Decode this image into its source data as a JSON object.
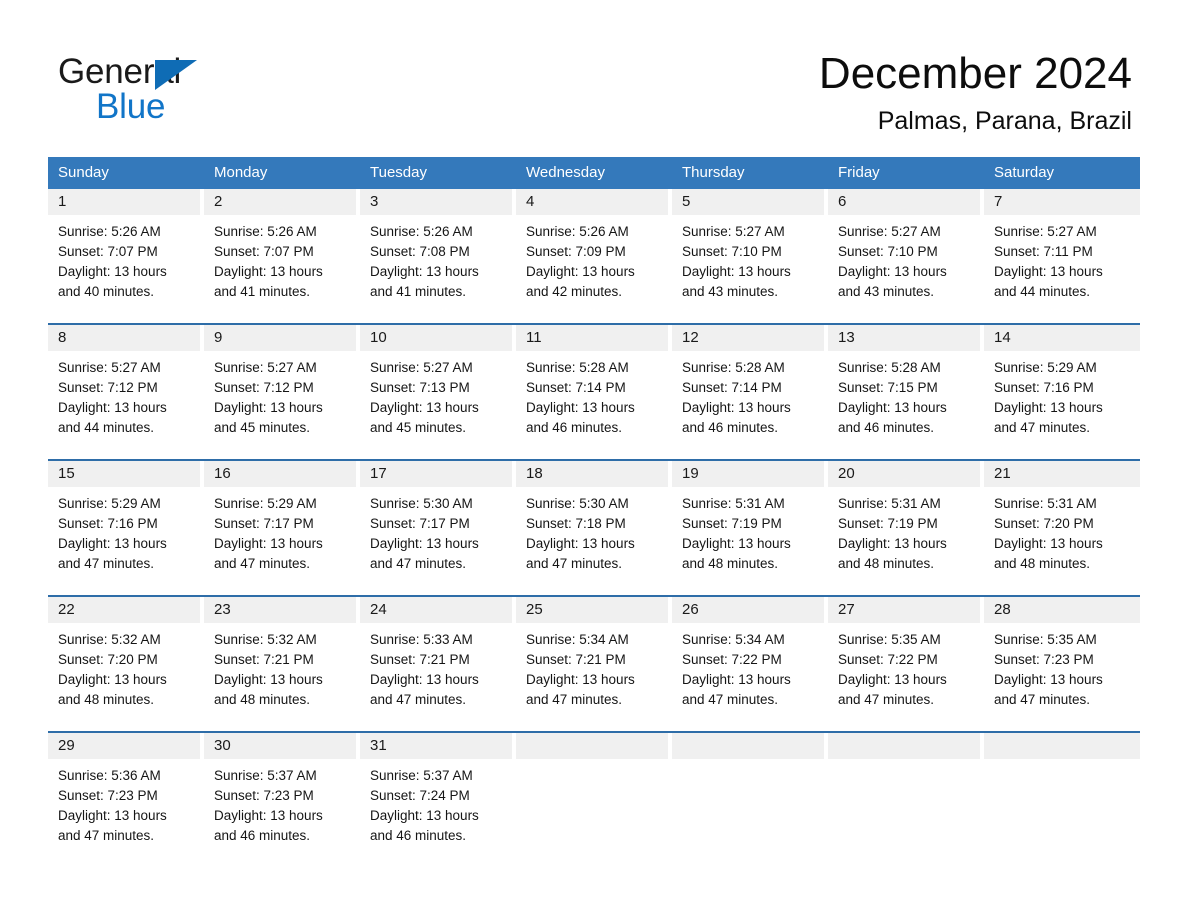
{
  "brand": {
    "name_part1": "General",
    "name_part2": "Blue",
    "accent_color": "#1175c8",
    "triangle_color": "#0f6cb5",
    "triangle_icon": "brand-triangle-icon"
  },
  "header": {
    "title": "December 2024",
    "subtitle": "Palmas, Parana, Brazil"
  },
  "calendar": {
    "header_bg": "#3479bb",
    "header_text_color": "#ffffff",
    "row_divider_color": "#2e6da8",
    "day_band_bg": "#f0f0f0",
    "weekdays": [
      "Sunday",
      "Monday",
      "Tuesday",
      "Wednesday",
      "Thursday",
      "Friday",
      "Saturday"
    ],
    "weeks": [
      [
        {
          "date": "1",
          "sunrise": "Sunrise: 5:26 AM",
          "sunset": "Sunset: 7:07 PM",
          "daylight_line1": "Daylight: 13 hours",
          "daylight_line2": "and 40 minutes."
        },
        {
          "date": "2",
          "sunrise": "Sunrise: 5:26 AM",
          "sunset": "Sunset: 7:07 PM",
          "daylight_line1": "Daylight: 13 hours",
          "daylight_line2": "and 41 minutes."
        },
        {
          "date": "3",
          "sunrise": "Sunrise: 5:26 AM",
          "sunset": "Sunset: 7:08 PM",
          "daylight_line1": "Daylight: 13 hours",
          "daylight_line2": "and 41 minutes."
        },
        {
          "date": "4",
          "sunrise": "Sunrise: 5:26 AM",
          "sunset": "Sunset: 7:09 PM",
          "daylight_line1": "Daylight: 13 hours",
          "daylight_line2": "and 42 minutes."
        },
        {
          "date": "5",
          "sunrise": "Sunrise: 5:27 AM",
          "sunset": "Sunset: 7:10 PM",
          "daylight_line1": "Daylight: 13 hours",
          "daylight_line2": "and 43 minutes."
        },
        {
          "date": "6",
          "sunrise": "Sunrise: 5:27 AM",
          "sunset": "Sunset: 7:10 PM",
          "daylight_line1": "Daylight: 13 hours",
          "daylight_line2": "and 43 minutes."
        },
        {
          "date": "7",
          "sunrise": "Sunrise: 5:27 AM",
          "sunset": "Sunset: 7:11 PM",
          "daylight_line1": "Daylight: 13 hours",
          "daylight_line2": "and 44 minutes."
        }
      ],
      [
        {
          "date": "8",
          "sunrise": "Sunrise: 5:27 AM",
          "sunset": "Sunset: 7:12 PM",
          "daylight_line1": "Daylight: 13 hours",
          "daylight_line2": "and 44 minutes."
        },
        {
          "date": "9",
          "sunrise": "Sunrise: 5:27 AM",
          "sunset": "Sunset: 7:12 PM",
          "daylight_line1": "Daylight: 13 hours",
          "daylight_line2": "and 45 minutes."
        },
        {
          "date": "10",
          "sunrise": "Sunrise: 5:27 AM",
          "sunset": "Sunset: 7:13 PM",
          "daylight_line1": "Daylight: 13 hours",
          "daylight_line2": "and 45 minutes."
        },
        {
          "date": "11",
          "sunrise": "Sunrise: 5:28 AM",
          "sunset": "Sunset: 7:14 PM",
          "daylight_line1": "Daylight: 13 hours",
          "daylight_line2": "and 46 minutes."
        },
        {
          "date": "12",
          "sunrise": "Sunrise: 5:28 AM",
          "sunset": "Sunset: 7:14 PM",
          "daylight_line1": "Daylight: 13 hours",
          "daylight_line2": "and 46 minutes."
        },
        {
          "date": "13",
          "sunrise": "Sunrise: 5:28 AM",
          "sunset": "Sunset: 7:15 PM",
          "daylight_line1": "Daylight: 13 hours",
          "daylight_line2": "and 46 minutes."
        },
        {
          "date": "14",
          "sunrise": "Sunrise: 5:29 AM",
          "sunset": "Sunset: 7:16 PM",
          "daylight_line1": "Daylight: 13 hours",
          "daylight_line2": "and 47 minutes."
        }
      ],
      [
        {
          "date": "15",
          "sunrise": "Sunrise: 5:29 AM",
          "sunset": "Sunset: 7:16 PM",
          "daylight_line1": "Daylight: 13 hours",
          "daylight_line2": "and 47 minutes."
        },
        {
          "date": "16",
          "sunrise": "Sunrise: 5:29 AM",
          "sunset": "Sunset: 7:17 PM",
          "daylight_line1": "Daylight: 13 hours",
          "daylight_line2": "and 47 minutes."
        },
        {
          "date": "17",
          "sunrise": "Sunrise: 5:30 AM",
          "sunset": "Sunset: 7:17 PM",
          "daylight_line1": "Daylight: 13 hours",
          "daylight_line2": "and 47 minutes."
        },
        {
          "date": "18",
          "sunrise": "Sunrise: 5:30 AM",
          "sunset": "Sunset: 7:18 PM",
          "daylight_line1": "Daylight: 13 hours",
          "daylight_line2": "and 47 minutes."
        },
        {
          "date": "19",
          "sunrise": "Sunrise: 5:31 AM",
          "sunset": "Sunset: 7:19 PM",
          "daylight_line1": "Daylight: 13 hours",
          "daylight_line2": "and 48 minutes."
        },
        {
          "date": "20",
          "sunrise": "Sunrise: 5:31 AM",
          "sunset": "Sunset: 7:19 PM",
          "daylight_line1": "Daylight: 13 hours",
          "daylight_line2": "and 48 minutes."
        },
        {
          "date": "21",
          "sunrise": "Sunrise: 5:31 AM",
          "sunset": "Sunset: 7:20 PM",
          "daylight_line1": "Daylight: 13 hours",
          "daylight_line2": "and 48 minutes."
        }
      ],
      [
        {
          "date": "22",
          "sunrise": "Sunrise: 5:32 AM",
          "sunset": "Sunset: 7:20 PM",
          "daylight_line1": "Daylight: 13 hours",
          "daylight_line2": "and 48 minutes."
        },
        {
          "date": "23",
          "sunrise": "Sunrise: 5:32 AM",
          "sunset": "Sunset: 7:21 PM",
          "daylight_line1": "Daylight: 13 hours",
          "daylight_line2": "and 48 minutes."
        },
        {
          "date": "24",
          "sunrise": "Sunrise: 5:33 AM",
          "sunset": "Sunset: 7:21 PM",
          "daylight_line1": "Daylight: 13 hours",
          "daylight_line2": "and 47 minutes."
        },
        {
          "date": "25",
          "sunrise": "Sunrise: 5:34 AM",
          "sunset": "Sunset: 7:21 PM",
          "daylight_line1": "Daylight: 13 hours",
          "daylight_line2": "and 47 minutes."
        },
        {
          "date": "26",
          "sunrise": "Sunrise: 5:34 AM",
          "sunset": "Sunset: 7:22 PM",
          "daylight_line1": "Daylight: 13 hours",
          "daylight_line2": "and 47 minutes."
        },
        {
          "date": "27",
          "sunrise": "Sunrise: 5:35 AM",
          "sunset": "Sunset: 7:22 PM",
          "daylight_line1": "Daylight: 13 hours",
          "daylight_line2": "and 47 minutes."
        },
        {
          "date": "28",
          "sunrise": "Sunrise: 5:35 AM",
          "sunset": "Sunset: 7:23 PM",
          "daylight_line1": "Daylight: 13 hours",
          "daylight_line2": "and 47 minutes."
        }
      ],
      [
        {
          "date": "29",
          "sunrise": "Sunrise: 5:36 AM",
          "sunset": "Sunset: 7:23 PM",
          "daylight_line1": "Daylight: 13 hours",
          "daylight_line2": "and 47 minutes."
        },
        {
          "date": "30",
          "sunrise": "Sunrise: 5:37 AM",
          "sunset": "Sunset: 7:23 PM",
          "daylight_line1": "Daylight: 13 hours",
          "daylight_line2": "and 46 minutes."
        },
        {
          "date": "31",
          "sunrise": "Sunrise: 5:37 AM",
          "sunset": "Sunset: 7:24 PM",
          "daylight_line1": "Daylight: 13 hours",
          "daylight_line2": "and 46 minutes."
        },
        {
          "date": "",
          "sunrise": "",
          "sunset": "",
          "daylight_line1": "",
          "daylight_line2": ""
        },
        {
          "date": "",
          "sunrise": "",
          "sunset": "",
          "daylight_line1": "",
          "daylight_line2": ""
        },
        {
          "date": "",
          "sunrise": "",
          "sunset": "",
          "daylight_line1": "",
          "daylight_line2": ""
        },
        {
          "date": "",
          "sunrise": "",
          "sunset": "",
          "daylight_line1": "",
          "daylight_line2": ""
        }
      ]
    ]
  }
}
